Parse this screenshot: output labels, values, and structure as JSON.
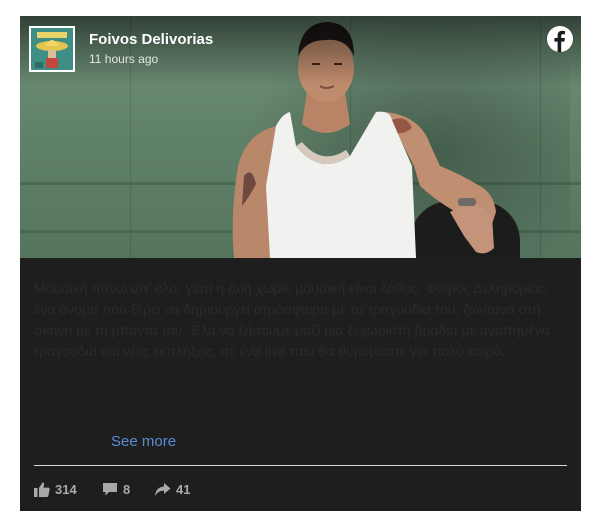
{
  "post": {
    "page_name": "Foivos Delivorias",
    "time": "11 hours ago",
    "body_text": "Μουσική πάνω απ' όλα, γιατί η ζωή χωρίς μουσική είναι λάθος. Φοίβος Δεληβοριάς, ένα όνομα που ξέρει να δημιουργεί ατμόσφαιρα με τα τραγούδια του, ζωντανά στη σκηνή με τη μπάντα του. Έλα να ζήσουμε μαζί μια ξεχωριστή βραδιά με αγαπημένα τραγούδια και νέες εκπλήξεις, σε ένα live που θα θυμόμαστε για πολύ καιρό.",
    "see_more": "See more",
    "stats": {
      "likes": "314",
      "comments": "8",
      "shares": "41"
    }
  },
  "icons": {
    "brand": "facebook-icon",
    "like": "thumbs-up-icon",
    "comment": "comment-icon",
    "share": "share-icon"
  },
  "colors": {
    "card_background": "#1e1e1e",
    "link": "#5b8ad6",
    "stats_text": "#a9a9a9"
  }
}
